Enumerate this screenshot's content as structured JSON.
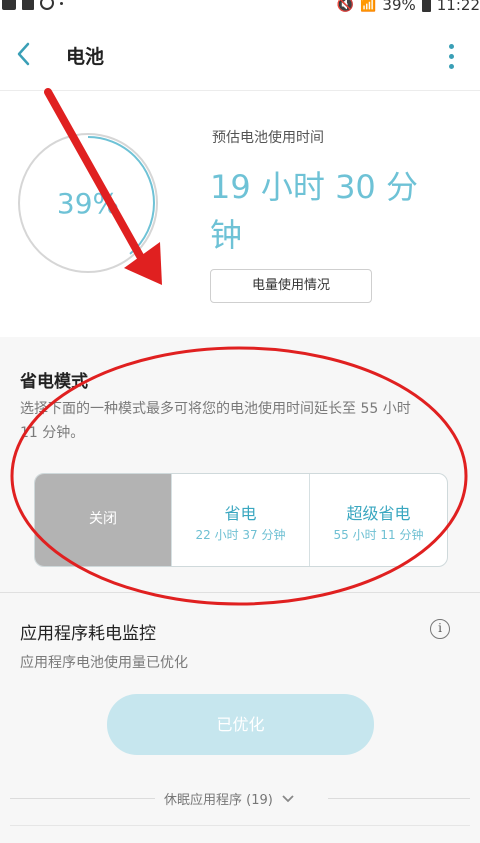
{
  "status_bar": {
    "battery_pct": "39%",
    "time": "11:22"
  },
  "header": {
    "title": "电池"
  },
  "battery": {
    "percent_text": "39%",
    "percent_value": 39,
    "estimate_label": "预估电池使用时间",
    "estimate_value": "19 小时 30 分钟",
    "usage_button": "电量使用情况"
  },
  "power_mode": {
    "title": "省电模式",
    "description": "选择下面的一种模式最多可将您的电池使用时间延长至 55 小时 11 分钟。",
    "modes": [
      {
        "label": "关闭",
        "time": "",
        "selected": true
      },
      {
        "label": "省电",
        "time": "22 小时 37 分钟",
        "selected": false
      },
      {
        "label": "超级省电",
        "time": "55 小时 11 分钟",
        "selected": false
      }
    ]
  },
  "app_monitor": {
    "title": "应用程序耗电监控",
    "status": "应用程序电池使用量已优化",
    "button": "已优化",
    "sleeping_apps": "休眠应用程序 (19)"
  },
  "icons": {
    "back": "chevron-left-icon",
    "more": "more-vert-icon",
    "info": "info-icon",
    "expand": "chevron-down-icon"
  },
  "colors": {
    "accent": "#3aa7c0",
    "accent_light": "#6ec2d6",
    "button_disabled": "#c6e6ee",
    "off_selected": "#b3b3b3",
    "annotation_red": "#e02020"
  }
}
